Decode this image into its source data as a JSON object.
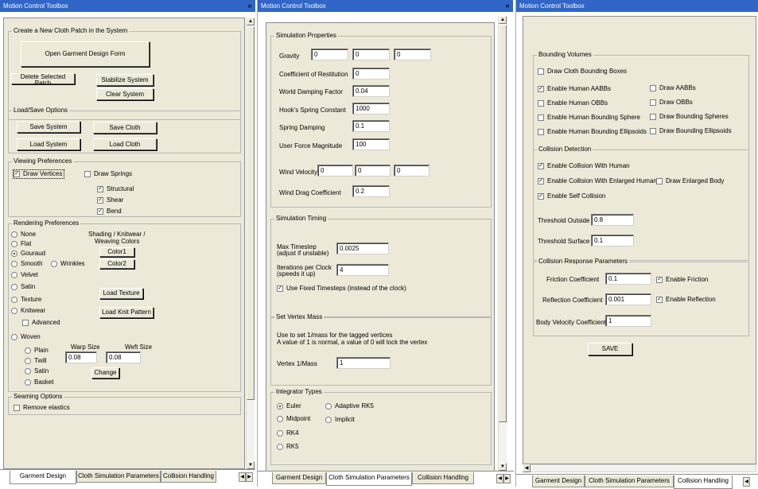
{
  "windows": [
    {
      "title": "Motion Control Toolbox",
      "close": "×"
    },
    {
      "title": "Motion Control Toolbox",
      "close": "×"
    },
    {
      "title": "Motion Control Toolbox"
    }
  ],
  "tabs": [
    "Garment Design",
    "Cloth Simulation Parameters",
    "Collision Handling"
  ],
  "tab_arrows": {
    "left": "◀",
    "right": "▶"
  },
  "scroll_arrows": {
    "up": "▲",
    "down": "▼",
    "left": "◀",
    "right": "▶"
  },
  "w1": {
    "create": {
      "title": "Create a New Cloth Patch in the System",
      "open": "Open Garment Design Form",
      "delete": "Delete Selected Patch",
      "stabilize": "Stabilize System",
      "clear": "Clear System"
    },
    "loadsave": {
      "title": "Load/Save Options",
      "save_system": "Save System",
      "save_cloth": "Save Cloth",
      "load_system": "Load System",
      "load_cloth": "Load Cloth"
    },
    "viewing": {
      "title": "Viewing Preferences",
      "draw_vertices": "Draw Vertices",
      "draw_springs": "Draw Springs",
      "structural": "Structural",
      "shear": "Shear",
      "bend": "Bend"
    },
    "rendering": {
      "title": "Rendering Preferences",
      "none": "None",
      "flat": "Flat",
      "gouraud": "Gouraud",
      "smooth": "Smooth",
      "wrinkles": "Wrinkles",
      "velvet": "Velvet",
      "satin": "Satin",
      "texture": "Texture",
      "knitwear": "Knitwear",
      "advanced": "Advanced",
      "woven": "Woven",
      "shading_line1": "Shading / Knitwear /",
      "shading_line2": "Weaving Colors",
      "color1": "Color1",
      "color2": "Color2",
      "load_texture": "Load Texture",
      "load_knit": "Load Knit Pattern",
      "plain": "Plain",
      "twill": "Twill",
      "satin2": "Satin",
      "basket": "Basket",
      "warp_label": "Warp Size",
      "weft_label": "Weft Size",
      "warp": "0.08",
      "weft": "0.08",
      "change": "Change"
    },
    "seaming": {
      "title": "Seaming Options",
      "remove": "Remove elastics"
    }
  },
  "w2": {
    "sim": {
      "title": "Simulation Properties",
      "gravity": "Gravity",
      "gx": "0",
      "gy": "0",
      "gz": "0",
      "restitution": "Coefficient of Restitution",
      "restitution_v": "0",
      "world_damping": "World Damping Factor",
      "world_damping_v": "0.04",
      "hook": "Hook's Spring Constant",
      "hook_v": "1000",
      "spring_damping": "Spring Damping",
      "spring_damping_v": "0.1",
      "user_force": "User Force Magnitude",
      "user_force_v": "100",
      "wind_velocity": "Wind Velocity",
      "wx": "0",
      "wy": "0",
      "wz": "0",
      "wind_drag": "Wind Drag Coefficient",
      "wind_drag_v": "0.2"
    },
    "timing": {
      "title": "Simulation Timing",
      "max_ts1": "Max Timestep",
      "max_ts2": "(adjust if unstable)",
      "max_ts_v": "0.0025",
      "iter1": "Iterations per Clock",
      "iter2": "(speeds it up)",
      "iter_v": "4",
      "fixed": "Use Fixed Timesteps (instead of the clock)"
    },
    "mass": {
      "title": "Set Vertex Mass",
      "desc1": "Use to set 1/mass for the tagged vertices",
      "desc2": "A value of 1 is normal, a value of 0 will lock the vertex",
      "vertex": "Vertex 1/Mass",
      "vertex_v": "1"
    },
    "integrator": {
      "title": "Integrator Types",
      "euler": "Euler",
      "midpoint": "Midpoint",
      "rk4": "RK4",
      "rk5": "RK5",
      "adaptive": "Adaptive RK5",
      "implicit": "Implicit"
    }
  },
  "w3": {
    "bv": {
      "title": "Bounding Volumes",
      "draw_cloth": "Draw Cloth Bounding Boxes",
      "human_aabb": "Enable Human AABBs",
      "human_obb": "Enable Human OBBs",
      "human_sphere": "Enable Human Bounding Sphere",
      "human_ellipsoids": "Enable Human Bounding Ellipsoids",
      "draw_aabb": "Draw AABBs",
      "draw_obb": "Draw OBBs",
      "draw_spheres": "Draw Bounding Spheres",
      "draw_ellipsoids": "Draw Bounding Ellipsoids"
    },
    "cd": {
      "title": "Collision Detection",
      "with_human": "Enable Collision With Human",
      "enlarged": "Enable Collision With Enlarged Human",
      "draw_enlarged": "Draw Enlarged Body",
      "self": "Enable Self Collision",
      "thr_out": "Threshold Outside",
      "thr_out_v": "0.8",
      "thr_surf": "Threshold Surface",
      "thr_surf_v": "0.1"
    },
    "cr": {
      "title": "Collision Response Parameters",
      "friction": "Friction Coefficient",
      "friction_v": "0.1",
      "enable_friction": "Enable Friction",
      "reflection": "Reflection Coefficient",
      "reflection_v": "0.001",
      "enable_reflection": "Enable Reflection",
      "body_vel": "Body Velocity Coefficient",
      "body_vel_v": "1"
    },
    "save": "SAVE"
  },
  "colors": {
    "titlebar": "#3165c8",
    "panel": "#ece9d8"
  }
}
